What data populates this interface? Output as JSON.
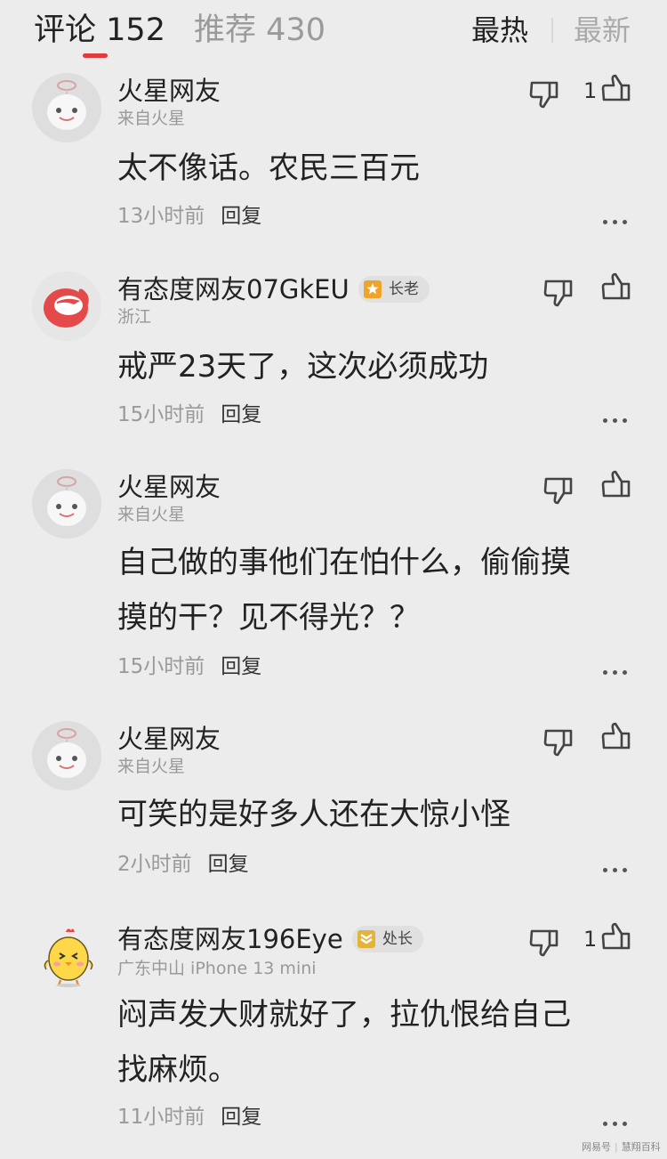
{
  "tabs": {
    "comments_label": "评论",
    "comments_count": "152",
    "recommend_label": "推荐",
    "recommend_count": "430"
  },
  "sort": {
    "hot": "最热",
    "new": "最新"
  },
  "reply_label": "回复",
  "comments": [
    {
      "username": "火星网友",
      "location": "来自火星",
      "badge": null,
      "text": "太不像话。农民三百元",
      "time": "13小时前",
      "likes": "1",
      "avatar": "mars-robot-avatar"
    },
    {
      "username": "有态度网友07GkEU",
      "location": "浙江",
      "badge": "长老",
      "text": "戒严23天了，这次必须成功",
      "time": "15小时前",
      "likes": "",
      "avatar": "netease-logo-avatar"
    },
    {
      "username": "火星网友",
      "location": "来自火星",
      "badge": null,
      "text": "自己做的事他们在怕什么，偷偷摸摸的干？见不得光？？",
      "time": "15小时前",
      "likes": "",
      "avatar": "mars-robot-avatar"
    },
    {
      "username": "火星网友",
      "location": "来自火星",
      "badge": null,
      "text": "可笑的是好多人还在大惊小怪",
      "time": "2小时前",
      "likes": "",
      "avatar": "mars-robot-avatar"
    },
    {
      "username": "有态度网友196Eye",
      "location": "广东中山  iPhone 13 mini",
      "badge": "处长",
      "text": "闷声发大财就好了，拉仇恨给自己找麻烦。",
      "time": "11小时前",
      "likes": "1",
      "avatar": "chick-cartoon-avatar"
    }
  ],
  "watermark": {
    "source": "网易号",
    "author": "慧翔百科"
  },
  "colors": {
    "accent": "#e23b3b",
    "background": "#ececec",
    "badge_orange": "#f0a32a"
  }
}
